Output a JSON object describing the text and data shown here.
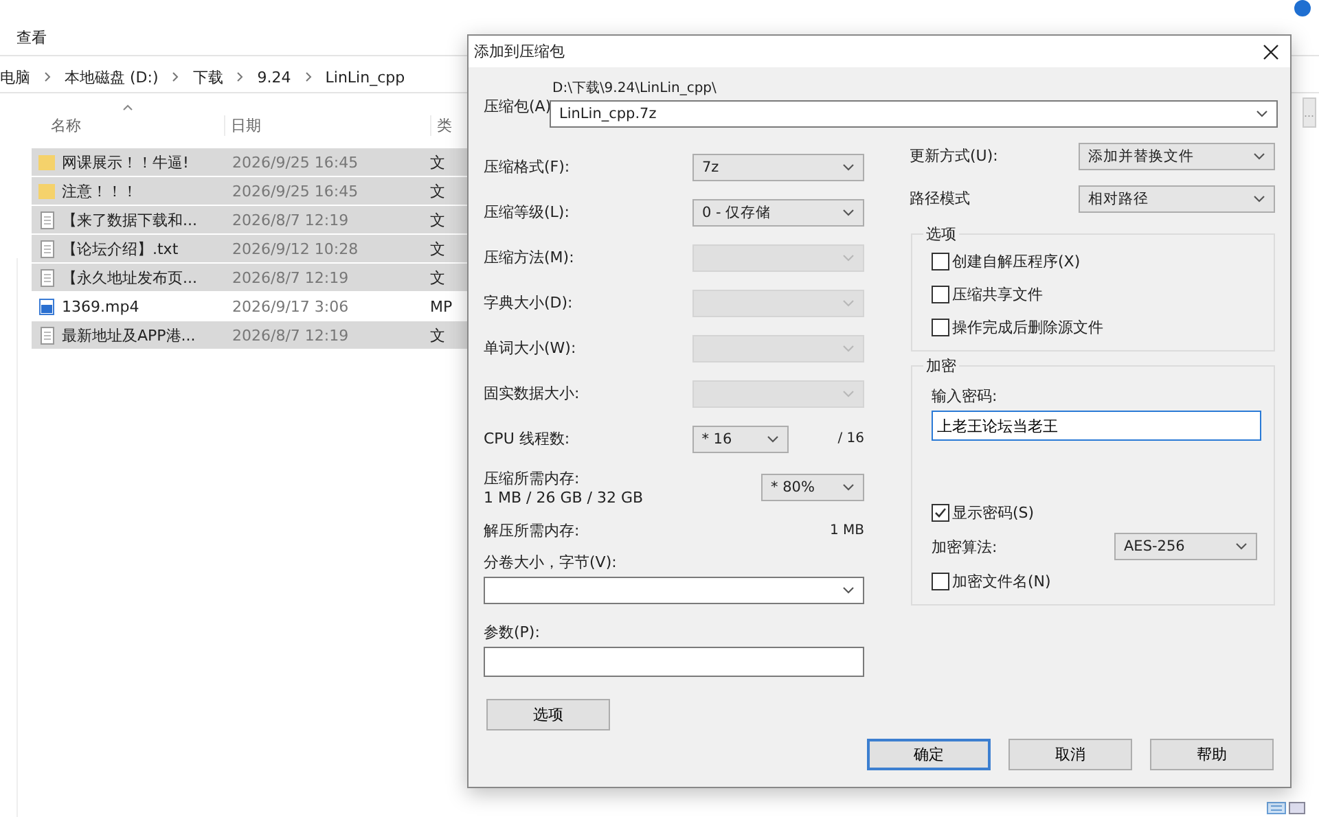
{
  "explorer": {
    "menu": "查看",
    "breadcrumb": [
      "电脑",
      "本地磁盘 (D:)",
      "下载",
      "9.24",
      "LinLin_cpp"
    ],
    "columns": [
      "名称",
      "日期",
      "类"
    ],
    "files": [
      {
        "name": "网课展示！！牛逼!",
        "date": "2026/9/25 16:45",
        "type": "文",
        "kind": "folder",
        "selected": true
      },
      {
        "name": "注意！！！",
        "date": "2026/9/25 16:45",
        "type": "文",
        "kind": "folder",
        "selected": true
      },
      {
        "name": "【来了数据下载和...",
        "date": "2026/8/7 12:19",
        "type": "文",
        "kind": "text",
        "selected": true
      },
      {
        "name": "【论坛介绍】.txt",
        "date": "2026/9/12 10:28",
        "type": "文",
        "kind": "text",
        "selected": true
      },
      {
        "name": "【永久地址发布页...",
        "date": "2026/8/7 12:19",
        "type": "文",
        "kind": "text",
        "selected": true
      },
      {
        "name": "1369.mp4",
        "date": "2026/9/17 3:06",
        "type": "MP",
        "kind": "video",
        "selected": false
      },
      {
        "name": "最新地址及APP港...",
        "date": "2026/8/7 12:19",
        "type": "文",
        "kind": "text",
        "selected": true
      }
    ]
  },
  "dialog": {
    "title": "添加到压缩包",
    "archive_label": "压缩包(A)",
    "archive_dir": "D:\\下载\\9.24\\LinLin_cpp\\",
    "archive_name": "LinLin_cpp.7z",
    "browse": "...",
    "left_fields": [
      {
        "label": "压缩格式(F):",
        "value": "7z",
        "disabled": false
      },
      {
        "label": "压缩等级(L):",
        "value": "0 - 仅存储",
        "disabled": false
      },
      {
        "label": "压缩方法(M):",
        "disabled": true
      },
      {
        "label": "字典大小(D):",
        "disabled": true
      },
      {
        "label": "单词大小(W):",
        "disabled": true
      },
      {
        "label": "固实数据大小:",
        "disabled": true
      }
    ],
    "threads": {
      "label": "CPU 线程数:",
      "value": "* 16",
      "total": "/ 16"
    },
    "memory": {
      "label": "压缩所需内存:",
      "detail": "1 MB / 26 GB / 32 GB",
      "value": "* 80%"
    },
    "decompress": {
      "label": "解压所需内存:",
      "value": "1 MB"
    },
    "split": {
      "label": "分卷大小，字节(V):"
    },
    "params": {
      "label": "参数(P):"
    },
    "options_button": "选项",
    "right_fields": [
      {
        "label": "更新方式(U):",
        "value": "添加并替换文件"
      },
      {
        "label": "路径模式",
        "value": "相对路径"
      }
    ],
    "options_group": {
      "title": "选项",
      "items": [
        {
          "label": "创建自解压程序(X)",
          "checked": false
        },
        {
          "label": "压缩共享文件",
          "checked": false
        },
        {
          "label": "操作完成后删除源文件",
          "checked": false
        }
      ]
    },
    "encryption": {
      "title": "加密",
      "password_label": "输入密码:",
      "password": "上老王论坛当老王",
      "show_password": {
        "label": "显示密码(S)",
        "checked": true
      },
      "method_label": "加密算法:",
      "method": "AES-256",
      "encrypt_names": {
        "label": "加密文件名(N)",
        "checked": false
      }
    },
    "buttons": [
      {
        "label": "确定",
        "default": true
      },
      {
        "label": "取消",
        "default": false
      },
      {
        "label": "帮助",
        "default": false
      }
    ]
  }
}
